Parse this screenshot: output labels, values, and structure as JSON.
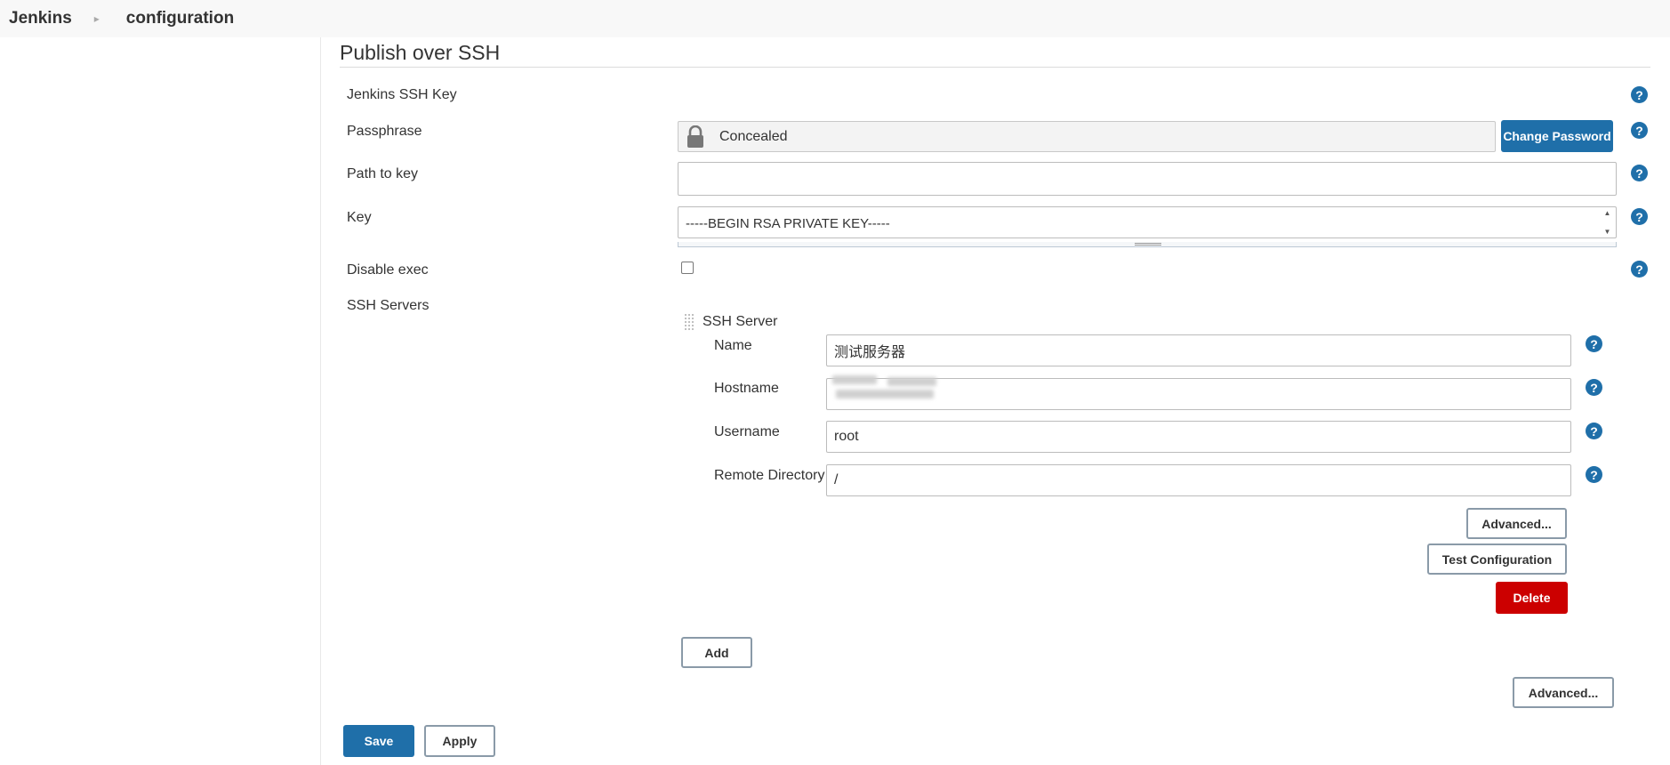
{
  "breadcrumb": {
    "root": "Jenkins",
    "current": "configuration"
  },
  "section": {
    "title": "Publish over SSH"
  },
  "fields": {
    "ssh_key_label": "Jenkins SSH Key",
    "passphrase_label": "Passphrase",
    "passphrase_value": "Concealed",
    "change_password_button": "Change Password",
    "path_to_key_label": "Path to key",
    "path_to_key_value": "",
    "key_label": "Key",
    "key_value": "-----BEGIN RSA PRIVATE KEY-----",
    "disable_exec_label": "Disable exec",
    "disable_exec_checked": false,
    "ssh_servers_label": "SSH Servers"
  },
  "ssh_server": {
    "header": "SSH Server",
    "name_label": "Name",
    "name_value": "测试服务器",
    "hostname_label": "Hostname",
    "hostname_value": "",
    "username_label": "Username",
    "username_value": "root",
    "remote_dir_label": "Remote Directory",
    "remote_dir_value": "/",
    "advanced_button": "Advanced...",
    "test_button": "Test Configuration",
    "delete_button": "Delete"
  },
  "actions": {
    "add_button": "Add",
    "advanced_button": "Advanced...",
    "save_button": "Save",
    "apply_button": "Apply"
  },
  "icons": {
    "help": "question-mark-circle-icon",
    "lock": "padlock-icon",
    "breadcrumb_sep": "chevron-right-icon",
    "drag": "drag-handle-icon"
  },
  "colors": {
    "primary": "#1f6fa9",
    "danger": "#cc0000",
    "topbar": "#f8f8f8"
  }
}
